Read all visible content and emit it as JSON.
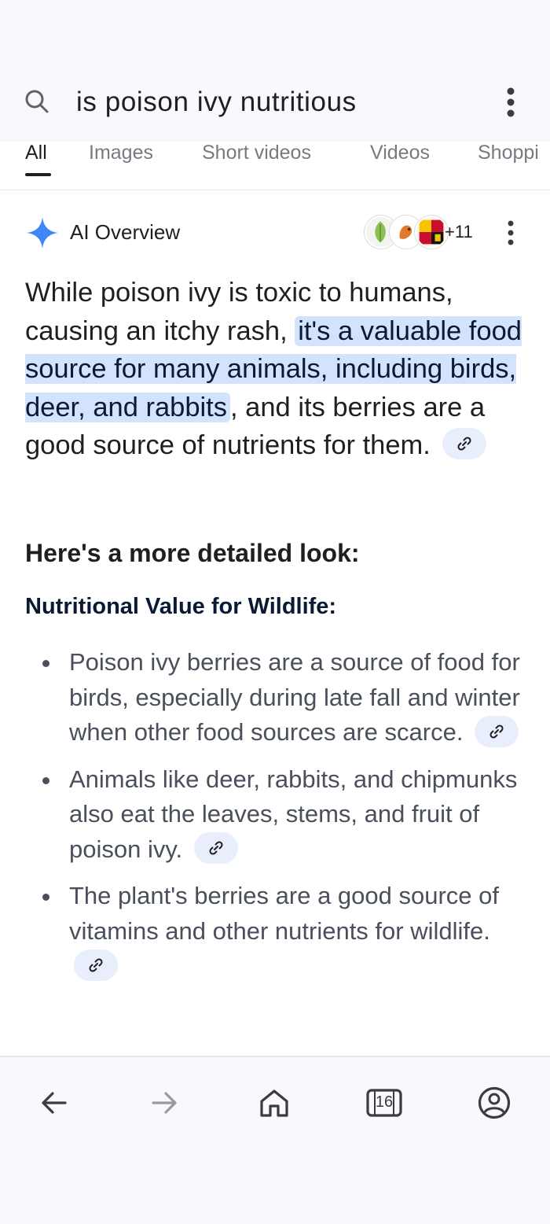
{
  "search": {
    "query": "is poison ivy nutritious"
  },
  "tabs": [
    {
      "label": "All",
      "active": true
    },
    {
      "label": "Images",
      "active": false
    },
    {
      "label": "Short videos",
      "active": false
    },
    {
      "label": "Videos",
      "active": false
    },
    {
      "label": "Shoppi",
      "active": false
    }
  ],
  "ai_overview": {
    "title": "AI Overview",
    "more_sources": "+11",
    "summary_part1": "While poison ivy is toxic to humans, causing an itchy rash, ",
    "summary_highlight": "it's a valuable food source for many animals, including birds, deer, and rabbits",
    "summary_part2": ", and its berries are a good source of nutrients for them.",
    "section_heading": "Here's a more detailed look:",
    "subheading": "Nutritional Value for Wildlife:",
    "bullets": [
      "Poison ivy berries are a source of food for birds, especially during late fall and winter when other food sources are scarce.",
      "Animals like deer, rabbits, and chipmunks also eat the leaves, stems, and fruit of poison ivy.",
      "The plant's berries are a good source of vitamins and other nutrients for wildlife."
    ]
  },
  "bottom_nav": {
    "tab_count": "16",
    "icons": [
      "back-icon",
      "forward-icon",
      "home-icon",
      "tabs-icon",
      "account-icon"
    ]
  },
  "colors": {
    "highlight": "#d3e3fd",
    "link_chip": "#e8eefb",
    "sparkle_blue": "#4285f4"
  }
}
